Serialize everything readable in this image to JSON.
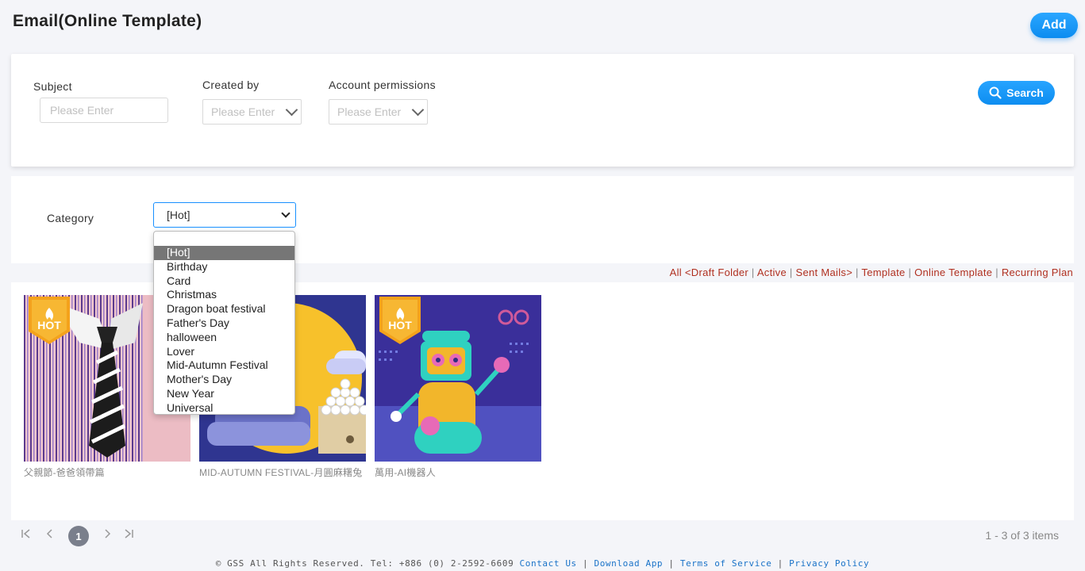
{
  "page_title": "Email(Online Template)",
  "add_label": "Add",
  "search": {
    "subject_label": "Subject",
    "subject_placeholder": "Please Enter",
    "created_by_label": "Created by",
    "created_by_value": "Please Enter",
    "account_permissions_label": "Account permissions",
    "account_permissions_value": "Please Enter",
    "search_label": "Search"
  },
  "category": {
    "label": "Category",
    "selected": "[Hot]",
    "options": [
      "[Hot]",
      "Birthday",
      "Card",
      "Christmas",
      "Dragon boat festival",
      "Father's Day",
      "halloween",
      "Lover",
      "Mid-Autumn Festival",
      "Mother's Day",
      "New Year",
      "Universal"
    ]
  },
  "nav": {
    "all": "All",
    "draft": "<Draft Folder",
    "active": "Active",
    "sent": "Sent Mails>",
    "template": "Template",
    "online_template": "Online Template",
    "recurring": "Recurring Plan"
  },
  "cards": [
    {
      "title": "父親節-爸爸領帶篇",
      "badge": "HOT"
    },
    {
      "title": "MID-AUTUMN FESTIVAL-月圓麻糬兔",
      "badge": ""
    },
    {
      "title": "萬用-AI機器人",
      "badge": "HOT"
    }
  ],
  "pagination": {
    "current": "1",
    "summary": "1 - 3 of 3 items"
  },
  "footer": {
    "copyright": "© GSS All Rights Reserved. Tel: +886 (0) 2-2592-6609",
    "contact": "Contact Us",
    "download": "Download App",
    "terms": "Terms of Service",
    "privacy": "Privacy Policy"
  },
  "colors": {
    "accent": "#1890ff",
    "link_red": "#b03020",
    "footer_link": "#1a73c8"
  }
}
